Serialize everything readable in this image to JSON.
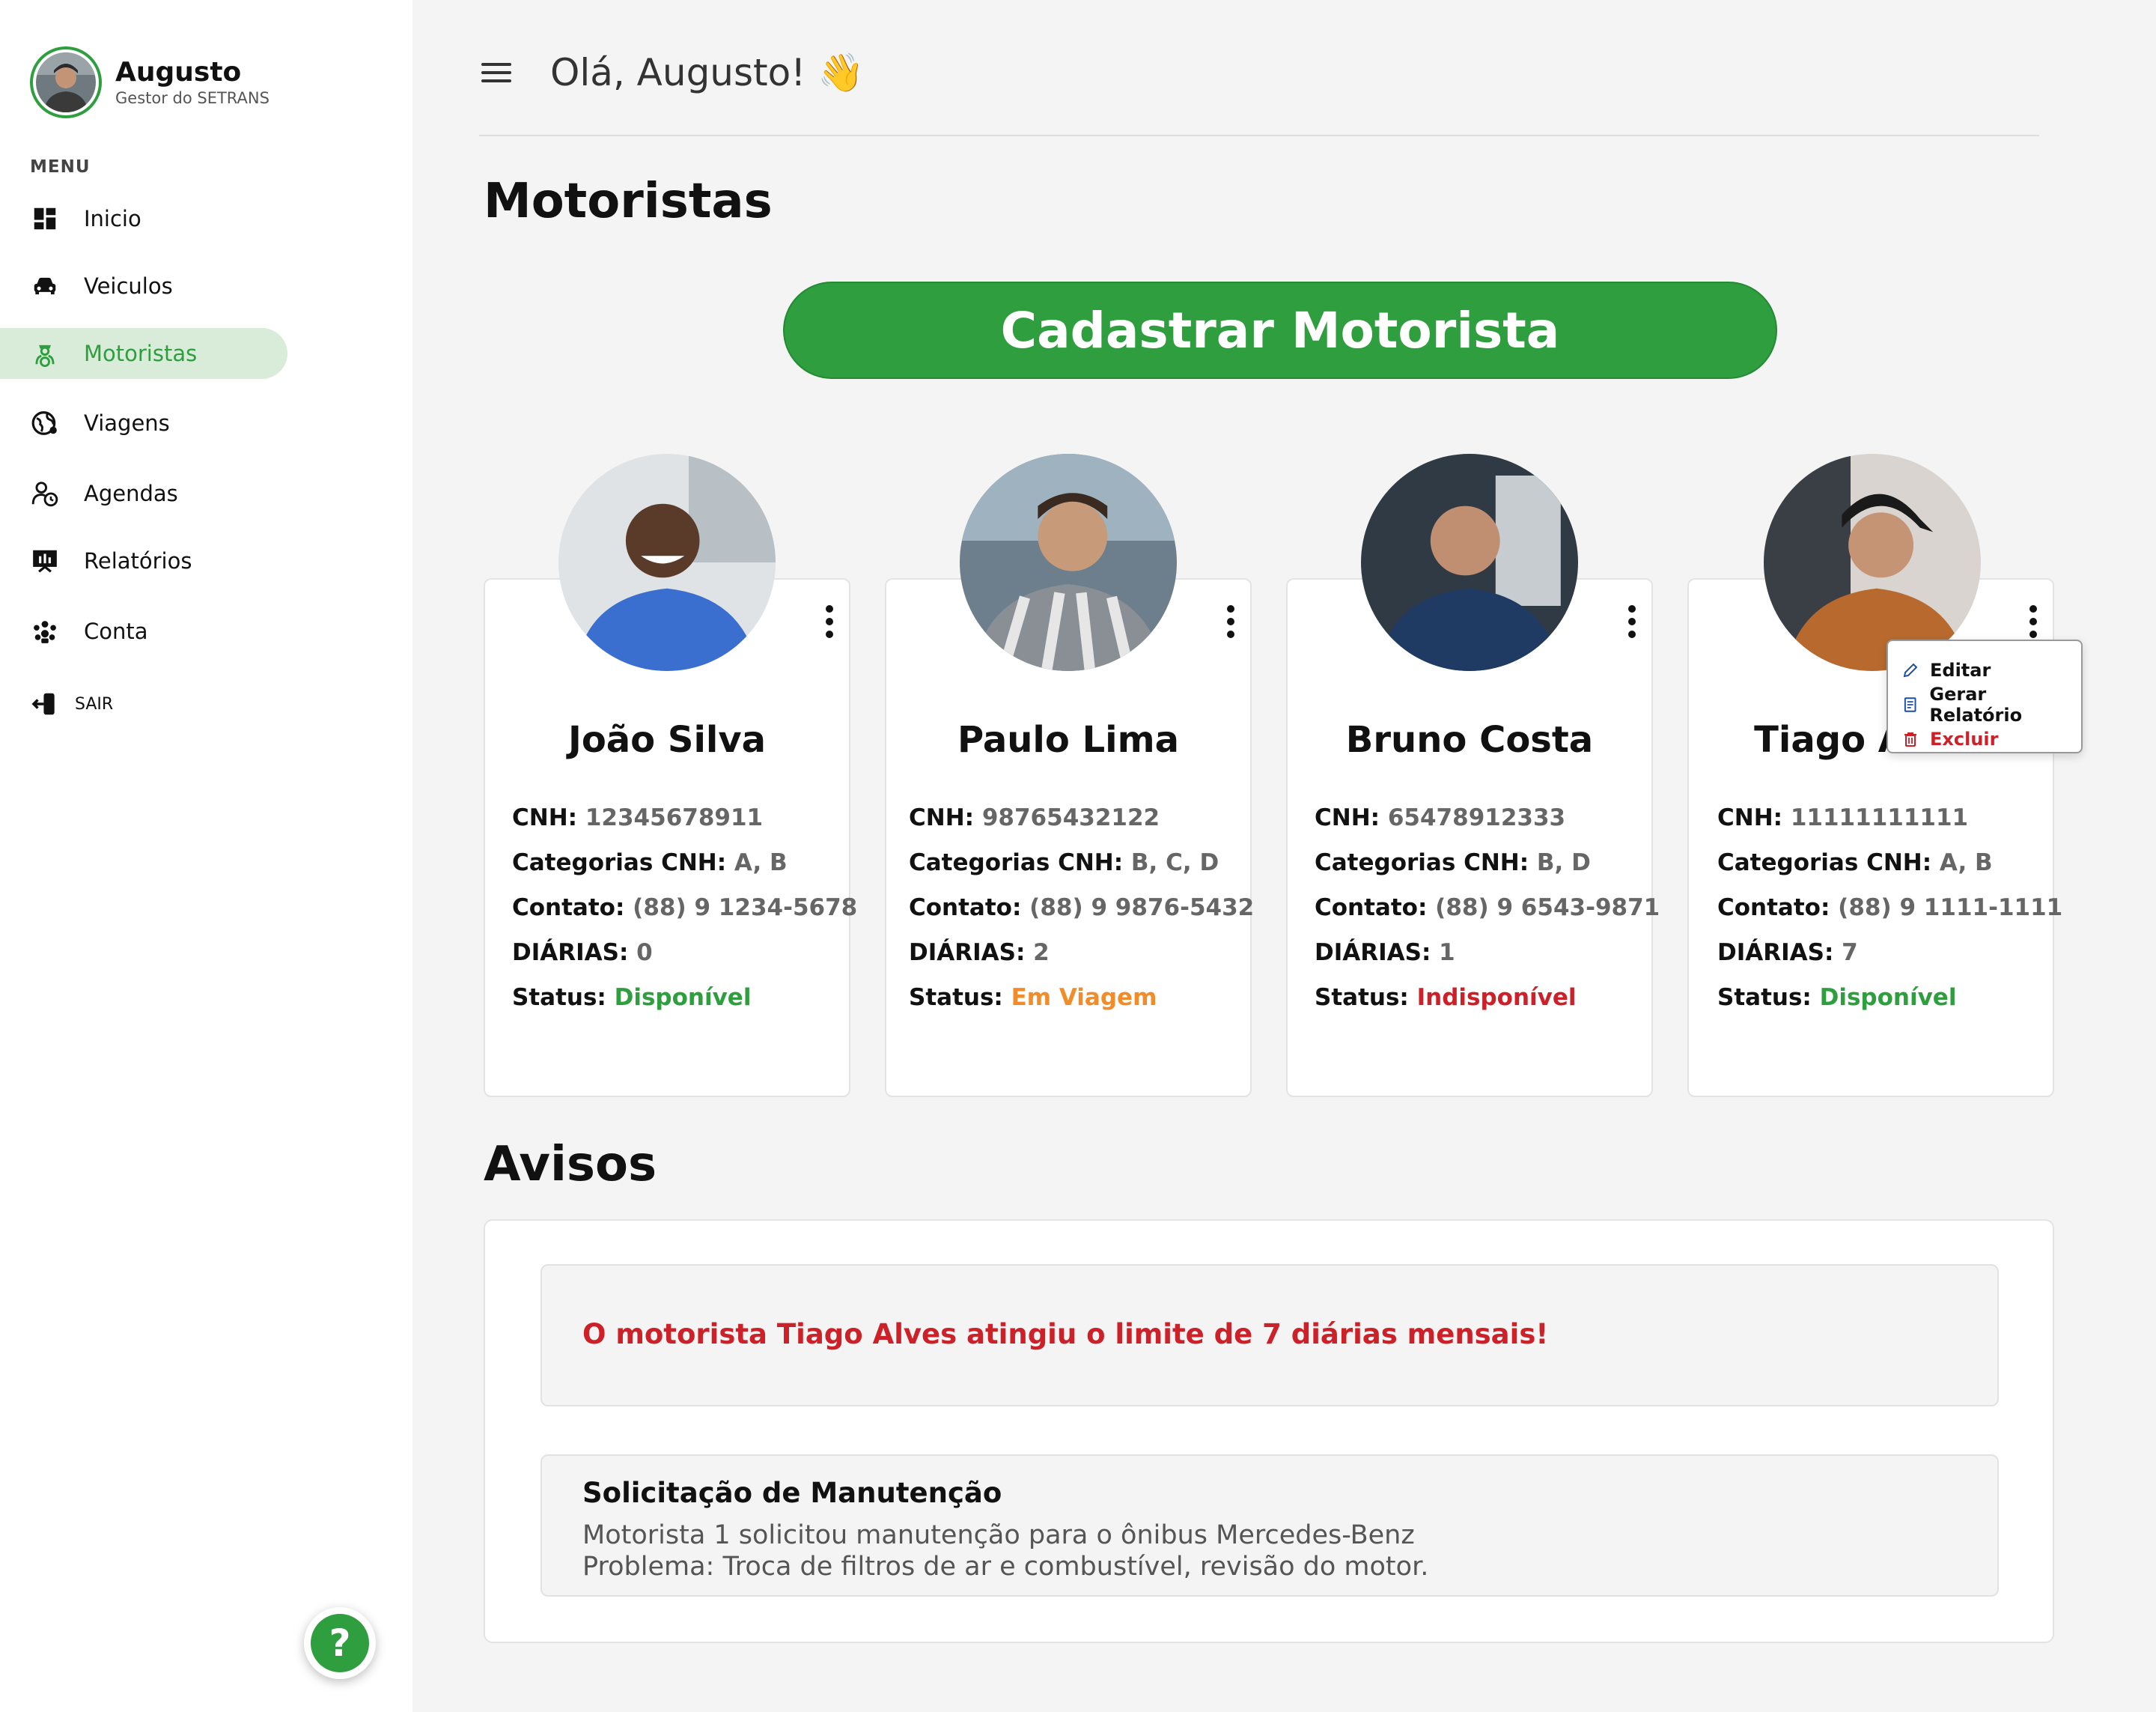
{
  "user": {
    "name": "Augusto",
    "role": "Gestor do SETRANS"
  },
  "menu": {
    "label": "MENU",
    "items": [
      {
        "label": "Inicio",
        "icon": "dashboard-icon",
        "active": false
      },
      {
        "label": "Veiculos",
        "icon": "car-icon",
        "active": false
      },
      {
        "label": "Motoristas",
        "icon": "driver-icon",
        "active": true
      },
      {
        "label": "Viagens",
        "icon": "globe-icon",
        "active": false
      },
      {
        "label": "Agendas",
        "icon": "person-clock-icon",
        "active": false
      },
      {
        "label": "Relatórios",
        "icon": "presentation-chart-icon",
        "active": false
      },
      {
        "label": "Conta",
        "icon": "group-icon",
        "active": false
      }
    ],
    "logout": {
      "label": "SAIR",
      "icon": "logout-icon"
    }
  },
  "header": {
    "greeting": "Olá, Augusto! 👋"
  },
  "page": {
    "title": "Motoristas",
    "cta": "Cadastrar Motorista"
  },
  "labels": {
    "cnh": "CNH: ",
    "categorias": "Categorias CNH: ",
    "contato": "Contato: ",
    "diarias": "DIÁRIAS: ",
    "status": "Status: "
  },
  "drivers": [
    {
      "name": "João Silva",
      "cnh": "12345678911",
      "categorias": "A, B",
      "contato": "(88) 9 1234-5678",
      "diarias": "0",
      "status": "Disponível",
      "status_color": "#2e9e3e"
    },
    {
      "name": "Paulo Lima",
      "cnh": "98765432122",
      "categorias": "B, C, D",
      "contato": "(88) 9 9876-5432",
      "diarias": "2",
      "status": "Em Viagem",
      "status_color": "#f08c2a"
    },
    {
      "name": "Bruno Costa",
      "cnh": "65478912333",
      "categorias": "B, D",
      "contato": "(88) 9 6543-9871",
      "diarias": "1",
      "status": "Indisponível",
      "status_color": "#cc2128"
    },
    {
      "name": "Tiago Alves",
      "cnh": "11111111111",
      "categorias": "A, B",
      "contato": "(88) 9 1111-1111",
      "diarias": "7",
      "status": "Disponível",
      "status_color": "#2e9e3e"
    }
  ],
  "dropdown": {
    "edit": "Editar",
    "report": "Gerar Relatório",
    "delete": "Excluir"
  },
  "avisos": {
    "title": "Avisos",
    "alert": "O motorista Tiago Alves atingiu o limite de 7 diárias mensais!",
    "maintenance": {
      "title": "Solicitação de Manutenção",
      "line1": "Motorista 1 solicitou manutenção para o ônibus Mercedes-Benz",
      "line2": "Problema: Troca de filtros de ar e combustível, revisão do motor."
    }
  },
  "help": {
    "label": "?"
  },
  "colors": {
    "brand": "#2e9e3e",
    "active_bg": "#d8ecd9",
    "danger": "#cc2128",
    "warning": "#f08c2a"
  }
}
